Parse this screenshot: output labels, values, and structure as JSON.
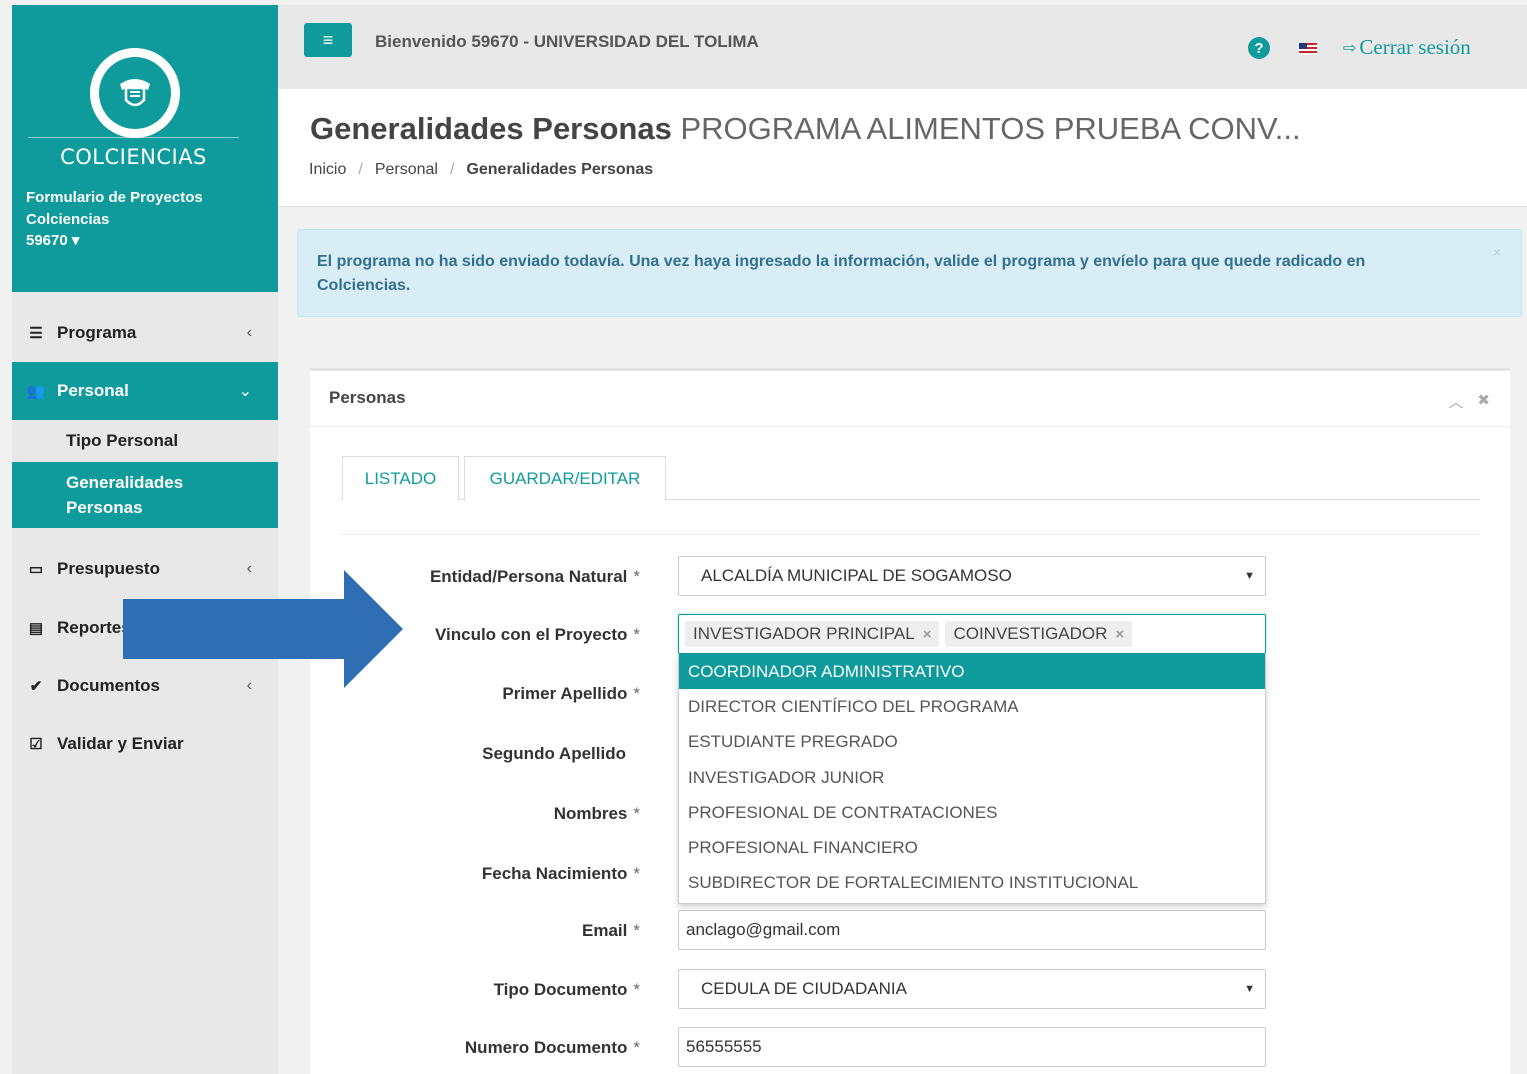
{
  "sidebar": {
    "brand_name": "COLCIENCIAS",
    "subtitle": "Formulario de Proyectos Colciencias",
    "user": "59670 ▾",
    "items": [
      {
        "label": "Programa",
        "icon": "list-icon",
        "chevron": "‹"
      },
      {
        "label": "Personal",
        "icon": "users-icon",
        "chevron": "⌄"
      },
      {
        "label": "Presupuesto",
        "icon": "money-icon",
        "chevron": "‹"
      },
      {
        "label": "Reportes",
        "icon": "file-icon",
        "chevron": ""
      },
      {
        "label": "Documentos",
        "icon": "check-circle-icon",
        "chevron": "‹"
      },
      {
        "label": "Validar y Enviar",
        "icon": "check-square-icon",
        "chevron": ""
      }
    ],
    "subitems": [
      {
        "label": "Tipo Personal"
      },
      {
        "label": "Generalidades Personas"
      }
    ]
  },
  "header": {
    "welcome": "Bienvenido 59670 - UNIVERSIDAD DEL TOLIMA",
    "logout_label": "Cerrar sesión"
  },
  "page": {
    "title_bold": "Generalidades Personas",
    "title_rest": "PROGRAMA ALIMENTOS PRUEBA CONV...",
    "breadcrumb": [
      "Inicio",
      "/",
      "Personal",
      "/",
      "Generalidades Personas"
    ]
  },
  "alert": {
    "text": "El programa no ha sido enviado todavía. Una vez haya ingresado la información, valide el programa y envíelo para que quede radicado en Colciencias.",
    "close": "×"
  },
  "panel": {
    "title": "Personas",
    "tabs": [
      "LISTADO",
      "GUARDAR/EDITAR"
    ]
  },
  "form": {
    "required_mark": "*",
    "entidad": {
      "label": "Entidad/Persona Natural",
      "value": "ALCALDÍA MUNICIPAL DE SOGAMOSO"
    },
    "vinculo": {
      "label": "Vinculo con el Proyecto",
      "tags": [
        "INVESTIGADOR PRINCIPAL",
        "COINVESTIGADOR"
      ],
      "options": [
        "COORDINADOR ADMINISTRATIVO",
        "DIRECTOR CIENTÍFICO DEL PROGRAMA",
        "ESTUDIANTE PREGRADO",
        "INVESTIGADOR JUNIOR",
        "PROFESIONAL DE CONTRATACIONES",
        "PROFESIONAL FINANCIERO",
        "SUBDIRECTOR DE FORTALECIMIENTO INSTITUCIONAL"
      ]
    },
    "primer_apellido": {
      "label": "Primer Apellido"
    },
    "segundo_apellido": {
      "label": "Segundo Apellido"
    },
    "nombres": {
      "label": "Nombres"
    },
    "fecha_nacimiento": {
      "label": "Fecha Nacimiento"
    },
    "email": {
      "label": "Email",
      "value": "anclago@gmail.com"
    },
    "tipo_documento": {
      "label": "Tipo Documento",
      "value": "CEDULA DE CIUDADANIA"
    },
    "numero_documento": {
      "label": "Numero Documento",
      "value": "56555555"
    }
  },
  "colors": {
    "accent": "#0f9b9b",
    "arrow": "#2f6eb2",
    "alert_bg": "#d9edf7"
  }
}
